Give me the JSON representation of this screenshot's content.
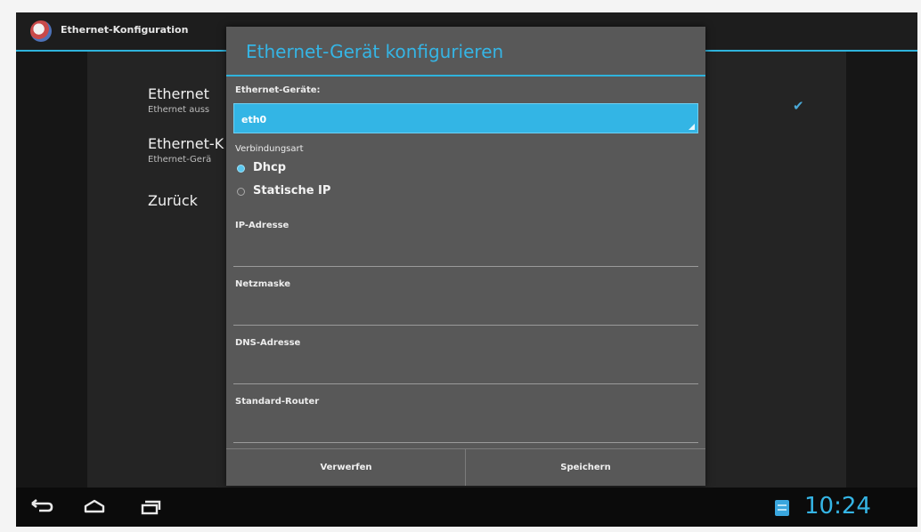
{
  "app": {
    "title": "Ethernet-Konfiguration"
  },
  "background_list": {
    "items": [
      {
        "title": "Ethernet",
        "subtitle": "Ethernet auss"
      },
      {
        "title": "Ethernet-K",
        "subtitle": "Ethernet-Gerä"
      },
      {
        "title": "Zurück",
        "subtitle": ""
      }
    ],
    "check_icon": "checkmark-icon"
  },
  "dialog": {
    "title": "Ethernet-Gerät konfigurieren",
    "device_label": "Ethernet-Geräte:",
    "device_value": "eth0",
    "connection_label": "Verbindungsart",
    "options": [
      {
        "label": "Dhcp",
        "checked": true
      },
      {
        "label": "Statische IP",
        "checked": false
      }
    ],
    "fields": [
      {
        "label": "IP-Adresse",
        "value": ""
      },
      {
        "label": "Netzmaske",
        "value": ""
      },
      {
        "label": "DNS-Adresse",
        "value": ""
      },
      {
        "label": "Standard-Router",
        "value": ""
      }
    ],
    "buttons": {
      "discard": "Verwerfen",
      "save": "Speichern"
    }
  },
  "navbar": {
    "icons": [
      "back-icon",
      "home-icon",
      "recent-apps-icon"
    ],
    "notification_icon": "notification-icon",
    "clock": "10:24"
  },
  "colors": {
    "accent": "#33b5e5",
    "dialog_bg": "#585858",
    "screen_bg": "#161616"
  }
}
